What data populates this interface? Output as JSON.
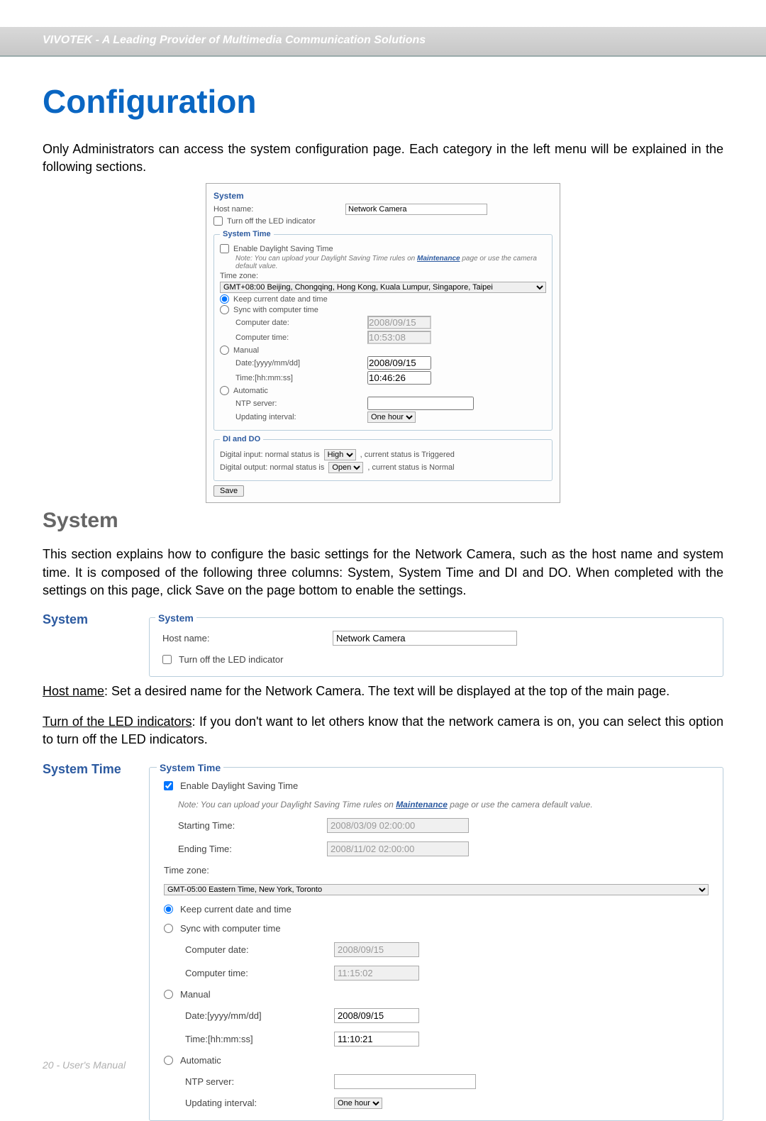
{
  "header": {
    "title": "VIVOTEK - A Leading Provider of Multimedia Communication Solutions"
  },
  "h1": "Configuration",
  "intro": "Only Administrators can access the system configuration page. Each category in the left menu will be explained in the following sections.",
  "shot1": {
    "title": "System",
    "hostname_label": "Host name:",
    "hostname_value": "Network Camera",
    "led_label": "Turn off the LED indicator",
    "st_title": "System Time",
    "dst_label": "Enable Daylight Saving Time",
    "dst_note_a": "Note: You can upload your Daylight Saving Time rules on ",
    "dst_note_link": "Maintenance",
    "dst_note_b": " page or use the camera default value.",
    "tz_label": "Time zone:",
    "tz_value": "GMT+08:00 Beijing, Chongqing, Hong Kong, Kuala Lumpur, Singapore, Taipei",
    "keep_label": "Keep current date and time",
    "sync_label": "Sync with computer time",
    "cdate_label": "Computer date:",
    "cdate_value": "2008/09/15",
    "ctime_label": "Computer time:",
    "ctime_value": "10:53:08",
    "manual_label": "Manual",
    "mdate_label": "Date:[yyyy/mm/dd]",
    "mdate_value": "2008/09/15",
    "mtime_label": "Time:[hh:mm:ss]",
    "mtime_value": "10:46:26",
    "auto_label": "Automatic",
    "ntp_label": "NTP server:",
    "upd_label": "Updating interval:",
    "upd_value": "One hour",
    "dido_title": "DI and DO",
    "di_a": "Digital input: normal status is ",
    "di_sel": "High",
    "di_b": " , current status is Triggered",
    "do_a": "Digital output: normal status is ",
    "do_sel": "Open",
    "do_b": " , current status is Normal",
    "save": "Save"
  },
  "h2": "System",
  "body1": "This section explains how to configure the basic settings for the Network Camera, such as the host name and system time. It is composed of the following three columns: System, System Time and DI and DO. When completed with the settings on this page, click Save on the page bottom to enable the settings.",
  "sub_system": "System",
  "panel1": {
    "title": "System",
    "hostname_label": "Host name:",
    "hostname_value": "Network Camera",
    "led_label": "Turn off the LED indicator"
  },
  "hostline_a": "Host name",
  "hostline_b": ": Set a desired name for the Network Camera. The text will be displayed at the top of the main page.",
  "ledline_a": "Turn of the LED indicators",
  "ledline_b": ": If you don't want to let others know that the network camera is on, you can select this option to turn off the LED indicators.",
  "sub_systime": "System Time",
  "panel2": {
    "title": "System Time",
    "dst_label": "Enable Daylight Saving Time",
    "dst_note_a": "Note: You can upload your Daylight Saving Time rules on ",
    "dst_note_link": "Maintenance",
    "dst_note_b": " page or use the camera default value.",
    "start_label": "Starting Time:",
    "start_value": "2008/03/09 02:00:00",
    "end_label": "Ending Time:",
    "end_value": "2008/11/02 02:00:00",
    "tz_label": "Time zone:",
    "tz_value": "GMT-05:00 Eastern Time, New York, Toronto",
    "keep_label": "Keep current date and time",
    "sync_label": "Sync with computer time",
    "cdate_label": "Computer date:",
    "cdate_value": "2008/09/15",
    "ctime_label": "Computer time:",
    "ctime_value": "11:15:02",
    "manual_label": "Manual",
    "mdate_label": "Date:[yyyy/mm/dd]",
    "mdate_value": "2008/09/15",
    "mtime_label": "Time:[hh:mm:ss]",
    "mtime_value": "11:10:21",
    "auto_label": "Automatic",
    "ntp_label": "NTP server:",
    "upd_label": "Updating interval:",
    "upd_value": "One hour"
  },
  "footer": "20 - User's Manual"
}
